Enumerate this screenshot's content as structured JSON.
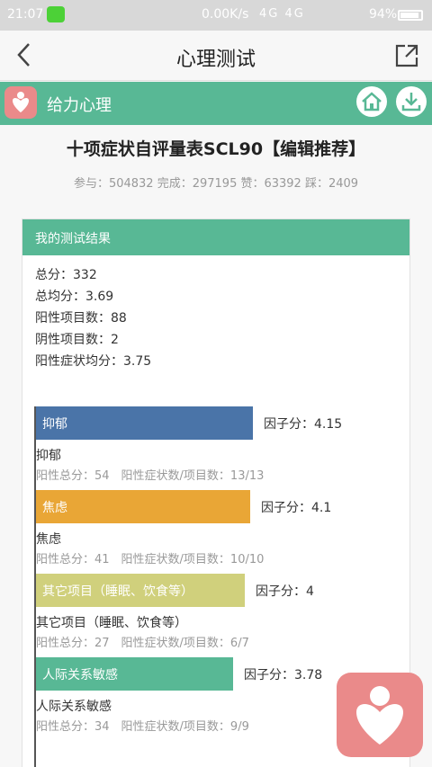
{
  "status_bar": {
    "time": "21:07",
    "network_speed": "0.00K/s",
    "signal": "4G 4G",
    "battery": "94%"
  },
  "header": {
    "back_icon": "chevron-left-icon",
    "title": "心理测试",
    "share_icon": "share-out-icon"
  },
  "app_bar": {
    "name": "给力心理",
    "home_icon": "home-icon",
    "download_icon": "download-icon"
  },
  "test": {
    "title": "十项症状自评量表SCL90【编辑推荐】",
    "stats": "参与：504832 完成：297195 赞：63392 踩：2409"
  },
  "result": {
    "header": "我的测试结果",
    "summary": [
      "总分：332",
      "总均分：3.69",
      "阳性项目数：88",
      "阴性项目数：2",
      "阳性症状均分：3.75"
    ]
  },
  "chart_data": {
    "type": "bar",
    "orientation": "horizontal",
    "categories": [
      "抑郁",
      "焦虑",
      "其它项目（睡眠、饮食等）",
      "人际关系敏感"
    ],
    "values": [
      4.15,
      4.1,
      4,
      3.78
    ],
    "colors": [
      "#4a74a8",
      "#e9a636",
      "#d0d07c",
      "#58b895"
    ],
    "xlim": [
      0,
      5
    ]
  },
  "factors": [
    {
      "bar_label": "抑郁",
      "score": "因子分：4.15",
      "name": "抑郁",
      "detail": "阳性总分：54　阳性症状数/项目数：13/13"
    },
    {
      "bar_label": "焦虑",
      "score": "因子分：4.1",
      "name": "焦虑",
      "detail": "阳性总分：41　阳性症状数/项目数：10/10"
    },
    {
      "bar_label": "其它项目（睡眠、饮食等）",
      "score": "因子分：4",
      "name": "其它项目（睡眠、饮食等）",
      "detail": "阳性总分：27　阳性症状数/项目数：6/7"
    },
    {
      "bar_label": "人际关系敏感",
      "score": "因子分：3.78",
      "name": "人际关系敏感",
      "detail": "阳性总分：34　阳性症状数/项目数：9/9"
    }
  ]
}
